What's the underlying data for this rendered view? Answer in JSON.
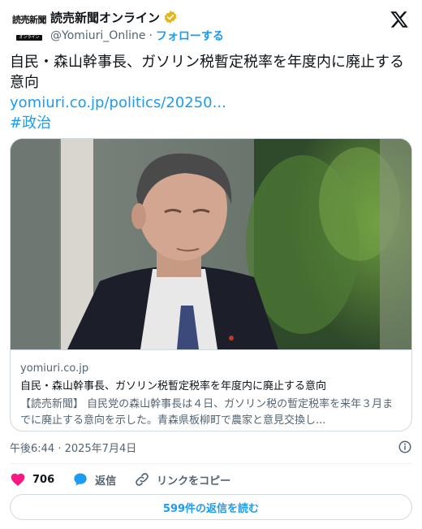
{
  "account": {
    "logo_main": "読売新聞",
    "logo_sub": "オンライン",
    "display_name": "読売新聞オンライン",
    "handle": "@Yomiuri_Online",
    "separator": "·",
    "follow_label": "フォローする"
  },
  "tweet": {
    "text": "自民・森山幹事長、ガソリン税暫定税率を年度内に廃止する意向",
    "link": "yomiuri.co.jp/politics/20250...",
    "hashtag": "#政治"
  },
  "card": {
    "domain": "yomiuri.co.jp",
    "title": "自民・森山幹事長、ガソリン税暫定税率を年度内に廃止する意向",
    "description": "【読売新聞】 自民党の森山幹事長は４日、ガソリン税の暫定税率を来年３月までに廃止する意向を示した。青森県板柳町で農家と意見交換し..."
  },
  "meta": {
    "timestamp": "午後6:44 · 2025年7月4日"
  },
  "actions": {
    "like_count": "706",
    "reply_label": "返信",
    "copy_link_label": "リンクをコピー"
  },
  "read_replies_label": "599件の返信を読む",
  "colors": {
    "accent": "#1d9bf0",
    "like": "#f91880",
    "verified": "#e2b719",
    "secondary_text": "#536471"
  }
}
